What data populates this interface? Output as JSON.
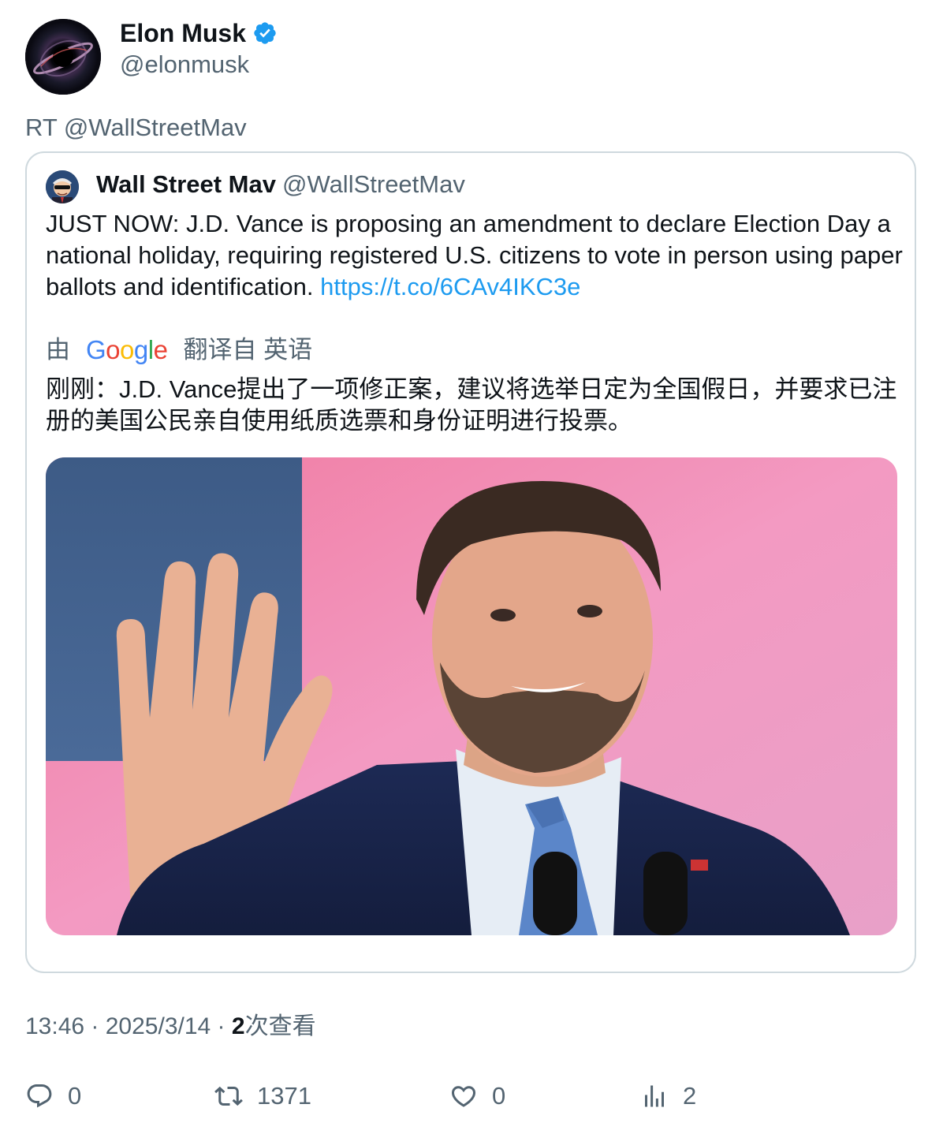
{
  "author": {
    "display_name": "Elon Musk",
    "handle": "@elonmusk",
    "verified": true,
    "avatar": "black-hole-avatar"
  },
  "retweet_line": "RT @WallStreetMav",
  "quoted": {
    "display_name": "Wall Street Mav",
    "handle": "@WallStreetMav",
    "avatar": "cartoon-trader-avatar",
    "text": "JUST NOW: J.D. Vance is proposing an amendment to declare Election Day a national holiday, requiring registered U.S. citizens to vote in person using paper ballots and identification. ",
    "link": "https://t.co/6CAv4IKC3e",
    "translation": {
      "prefix": "由",
      "provider": "Google",
      "suffix": "翻译自 英语",
      "text": "刚刚：J.D. Vance提出了一项修正案，建议将选举日定为全国假日，并要求已注册的美国公民亲自使用纸质选票和身份证明进行投票。"
    },
    "image": "photo-man-waving-at-podium"
  },
  "meta": {
    "time": "13:46",
    "sep1": " · ",
    "date": "2025/3/14",
    "sep2": " · ",
    "views_count": "2",
    "views_label": "次查看"
  },
  "actions": {
    "reply": {
      "icon": "reply-icon",
      "count": "0"
    },
    "retweet": {
      "icon": "retweet-icon",
      "count": "1371"
    },
    "like": {
      "icon": "heart-icon",
      "count": "0"
    },
    "views": {
      "icon": "views-chart-icon",
      "count": "2"
    }
  },
  "colors": {
    "link": "#1d9bf0",
    "verified": "#1d9bf0",
    "secondary_text": "#536471",
    "border": "#cfd9de"
  }
}
